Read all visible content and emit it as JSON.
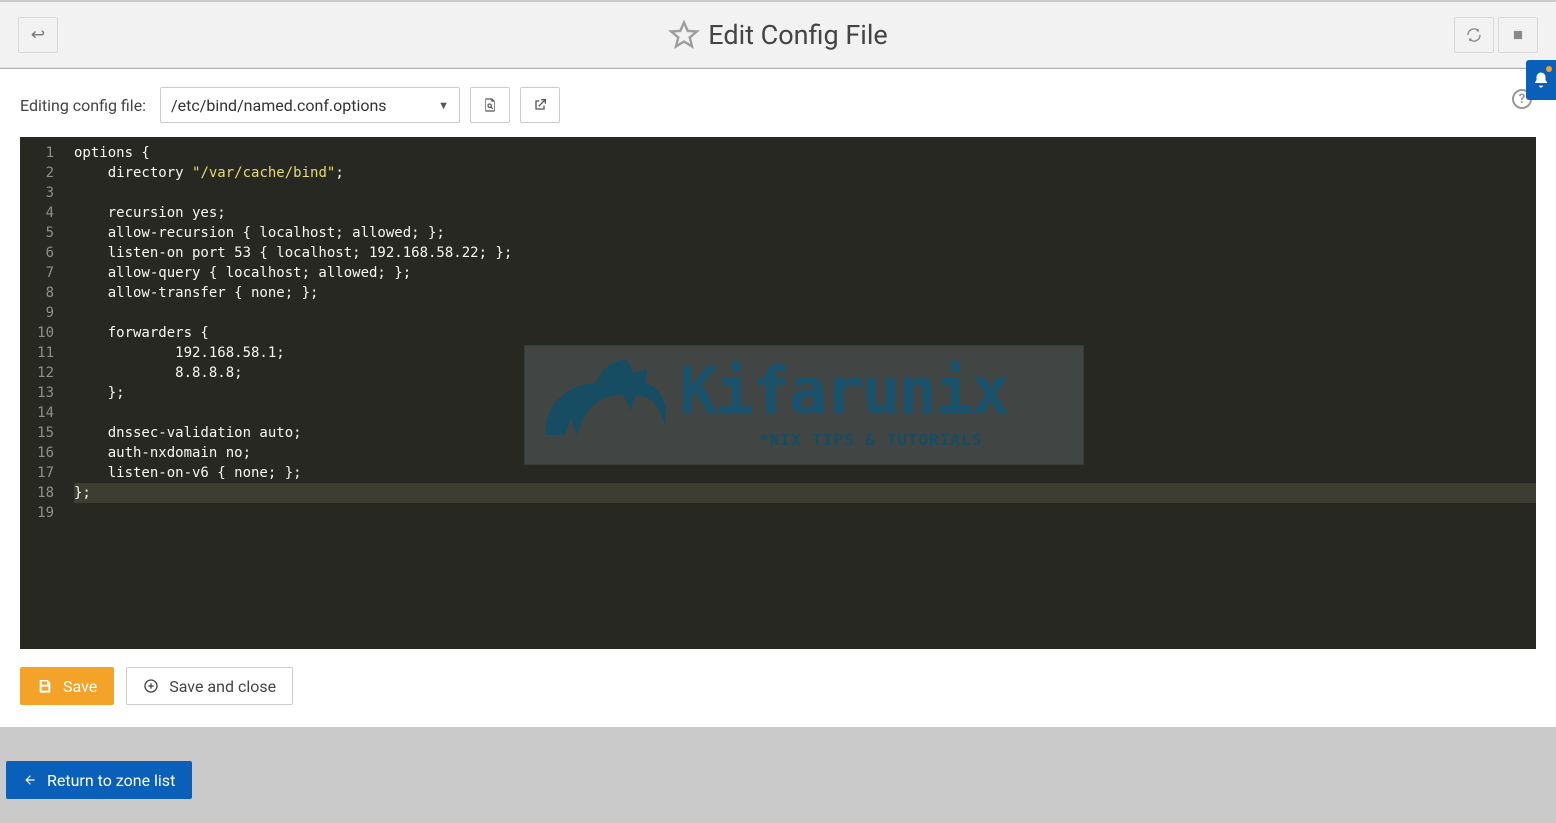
{
  "header": {
    "title": "Edit Config File"
  },
  "toolbar": {
    "label": "Editing config file:",
    "selected_file": "/etc/bind/named.conf.options"
  },
  "editor": {
    "total_lines": 19,
    "highlighted_line": 18,
    "lines": [
      {
        "n": 1,
        "pre": "options {",
        "str": "",
        "post": ""
      },
      {
        "n": 2,
        "pre": "    directory ",
        "str": "\"/var/cache/bind\"",
        "post": ";"
      },
      {
        "n": 3,
        "pre": "",
        "str": "",
        "post": ""
      },
      {
        "n": 4,
        "pre": "    recursion yes;",
        "str": "",
        "post": ""
      },
      {
        "n": 5,
        "pre": "    allow-recursion { localhost; allowed; };",
        "str": "",
        "post": ""
      },
      {
        "n": 6,
        "pre": "    listen-on port 53 { localhost; 192.168.58.22; };",
        "str": "",
        "post": ""
      },
      {
        "n": 7,
        "pre": "    allow-query { localhost; allowed; };",
        "str": "",
        "post": ""
      },
      {
        "n": 8,
        "pre": "    allow-transfer { none; };",
        "str": "",
        "post": ""
      },
      {
        "n": 9,
        "pre": "",
        "str": "",
        "post": ""
      },
      {
        "n": 10,
        "pre": "    forwarders {",
        "str": "",
        "post": ""
      },
      {
        "n": 11,
        "pre": "            192.168.58.1;",
        "str": "",
        "post": ""
      },
      {
        "n": 12,
        "pre": "            8.8.8.8;",
        "str": "",
        "post": ""
      },
      {
        "n": 13,
        "pre": "    };",
        "str": "",
        "post": ""
      },
      {
        "n": 14,
        "pre": "",
        "str": "",
        "post": ""
      },
      {
        "n": 15,
        "pre": "    dnssec-validation auto;",
        "str": "",
        "post": ""
      },
      {
        "n": 16,
        "pre": "    auth-nxdomain no;",
        "str": "",
        "post": ""
      },
      {
        "n": 17,
        "pre": "    listen-on-v6 { none; };",
        "str": "",
        "post": ""
      },
      {
        "n": 18,
        "pre": "};",
        "str": "",
        "post": ""
      },
      {
        "n": 19,
        "pre": "",
        "str": "",
        "post": ""
      }
    ]
  },
  "watermark": {
    "main": "Kifarunix",
    "sub": "*NIX TIPS & TUTORIALS"
  },
  "actions": {
    "save": "Save",
    "save_close": "Save and close",
    "return": "Return to zone list"
  }
}
